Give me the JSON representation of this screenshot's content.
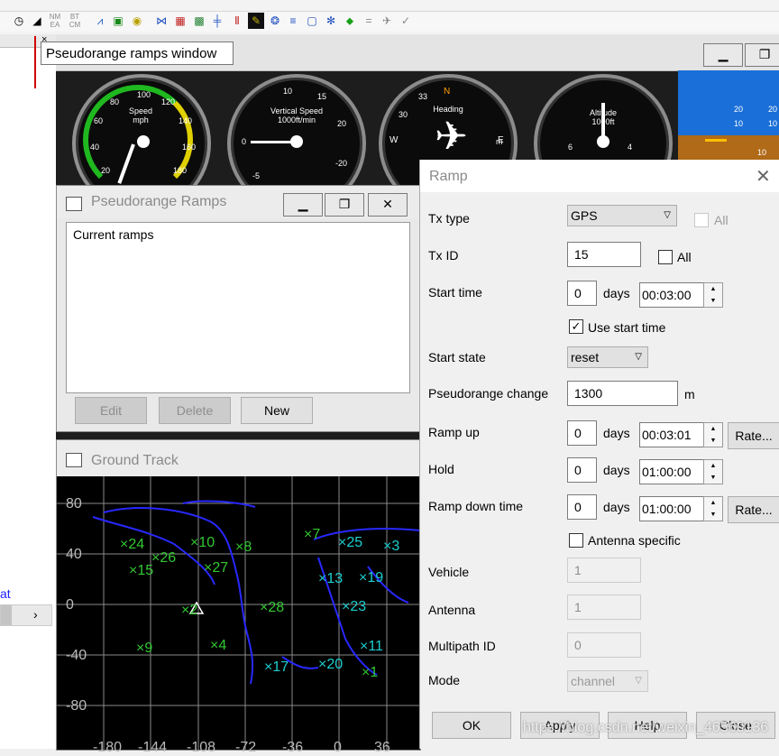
{
  "tooltip": {
    "text": "Pseudorange ramps window"
  },
  "toolbar": {
    "nm_ea": "NM\nEA",
    "bt_cm": "BT\nCM",
    "close_mark": "×"
  },
  "left_panel": {
    "link_text": "at"
  },
  "gauges": {
    "speed": {
      "title": "Speed",
      "unit": "mph",
      "ticks": [
        "20",
        "40",
        "60",
        "80",
        "100",
        "120",
        "140",
        "160",
        "180"
      ]
    },
    "vertical_speed": {
      "title": "Vertical Speed",
      "unit": "1000ft/min",
      "ticks": [
        "10",
        "15",
        "20",
        "-20",
        "-5",
        "0"
      ]
    },
    "heading": {
      "title": "Heading",
      "ticks": [
        "N",
        "E",
        "W",
        "33",
        "30",
        "m"
      ]
    },
    "altitude": {
      "title": "Altitude",
      "unit": "1000ft",
      "ticks": [
        "6",
        "4"
      ]
    },
    "attitude": {
      "ticks": [
        "20",
        "10",
        "20",
        "10",
        "10"
      ]
    }
  },
  "pr_window": {
    "title": "Pseudorange Ramps",
    "list_header": "Current ramps",
    "edit": "Edit",
    "delete": "Delete",
    "new": "New"
  },
  "ground_track": {
    "title": "Ground Track",
    "y_ticks": [
      "80",
      "40",
      "0",
      "-40",
      "-80"
    ],
    "x_ticks": [
      "-180",
      "-144",
      "-108",
      "-72",
      "-36",
      "0",
      "36"
    ],
    "sats": [
      {
        "id": "×24",
        "c": false
      },
      {
        "id": "×26",
        "c": false
      },
      {
        "id": "×10",
        "c": false
      },
      {
        "id": "×8",
        "c": false
      },
      {
        "id": "×15",
        "c": false
      },
      {
        "id": "×27",
        "c": false
      },
      {
        "id": "×7",
        "c": false
      },
      {
        "id": "×25",
        "c": true
      },
      {
        "id": "×3",
        "c": true
      },
      {
        "id": "×13",
        "c": true
      },
      {
        "id": "×19",
        "c": true
      },
      {
        "id": "×2",
        "c": false
      },
      {
        "id": "×28",
        "c": false
      },
      {
        "id": "×23",
        "c": true
      },
      {
        "id": "×9",
        "c": false
      },
      {
        "id": "×4",
        "c": false
      },
      {
        "id": "×11",
        "c": true
      },
      {
        "id": "×17",
        "c": true
      },
      {
        "id": "×20",
        "c": true
      },
      {
        "id": "×1",
        "c": false
      }
    ]
  },
  "ramp": {
    "title": "Ramp",
    "tx_type_label": "Tx type",
    "tx_type_value": "GPS",
    "all_label": "All",
    "tx_id_label": "Tx ID",
    "tx_id_value": "15",
    "start_time_label": "Start time",
    "start_days": "0",
    "days": "days",
    "start_time": "00:03:00",
    "use_start_time": "Use start time",
    "start_state_label": "Start state",
    "start_state_value": "reset",
    "pr_change_label": "Pseudorange change",
    "pr_change_value": "1300",
    "pr_unit": "m",
    "ramp_up_label": "Ramp up",
    "ramp_up_days": "0",
    "ramp_up_time": "00:03:01",
    "rate_label": "Rate...",
    "hold_label": "Hold",
    "hold_days": "0",
    "hold_time": "01:00:00",
    "ramp_down_label": "Ramp down time",
    "ramp_down_days": "0",
    "ramp_down_time": "01:00:00",
    "antenna_specific": "Antenna specific",
    "vehicle_label": "Vehicle",
    "vehicle_value": "1",
    "antenna_label": "Antenna",
    "antenna_value": "1",
    "multipath_label": "Multipath ID",
    "multipath_value": "0",
    "mode_label": "Mode",
    "mode_value": "channel",
    "ok": "OK",
    "apply": "Apply",
    "help": "Help",
    "close": "Close"
  },
  "watermark": "https://blog.csdn.net/weixin_46560136"
}
